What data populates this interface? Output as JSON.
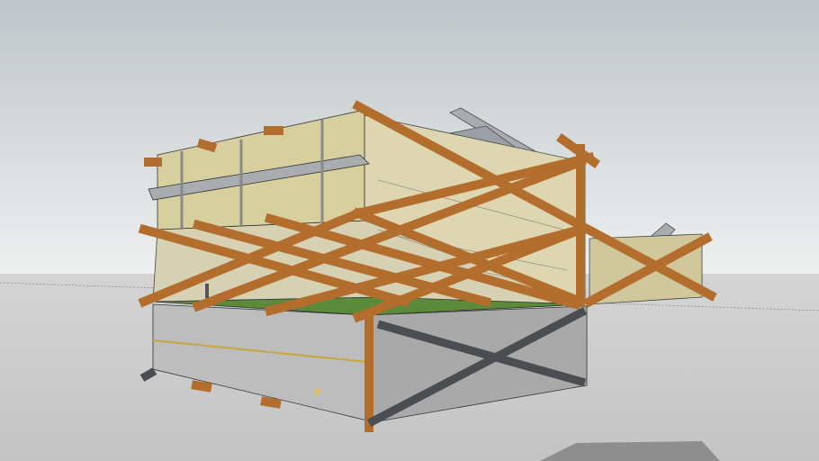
{
  "scene": {
    "colors": {
      "sky_top": "#bfc5c9",
      "sky_horizon": "#eef0f0",
      "ground": "#c9c9c9",
      "timber": "#b36d2c",
      "timber_dark": "#7a4418",
      "insulation": "#d8cf9e",
      "concrete": "#b9b9b9",
      "concrete_dark": "#a2a2a2",
      "green_roof": "#5a8a3a",
      "steel": "#9a9ea3",
      "steel_dark": "#4a4d52"
    }
  }
}
